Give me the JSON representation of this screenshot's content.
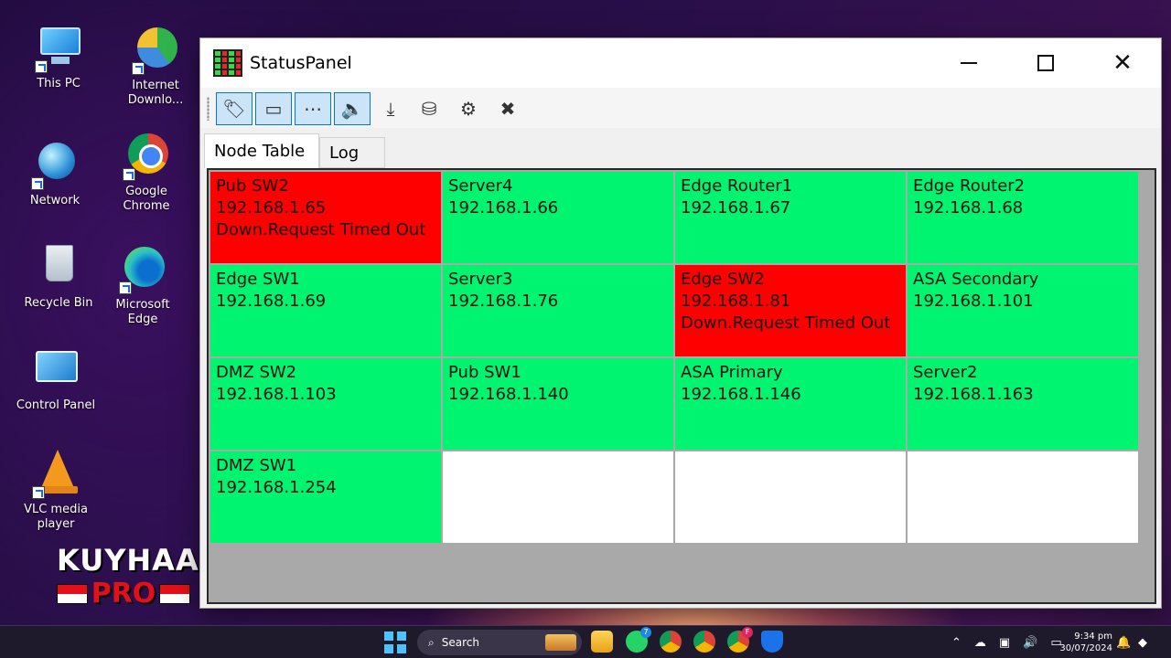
{
  "desktop": {
    "icons": [
      {
        "label_1": "This PC",
        "label_2": ""
      },
      {
        "label_1": "Internet",
        "label_2": "Downlo..."
      },
      {
        "label_1": "Network",
        "label_2": ""
      },
      {
        "label_1": "Google",
        "label_2": "Chrome"
      },
      {
        "label_1": "Recycle Bin",
        "label_2": ""
      },
      {
        "label_1": "Microsoft",
        "label_2": "Edge"
      },
      {
        "label_1": "Control Panel",
        "label_2": ""
      },
      {
        "label_1": "VLC media",
        "label_2": "player"
      }
    ],
    "watermark": {
      "line1": "KUYHAA",
      "line2": "PRO"
    }
  },
  "window": {
    "title": "StatusPanel",
    "controls": {
      "minimize_icon": "minimize-icon",
      "maximize_icon": "maximize-icon",
      "close_icon": "close-icon",
      "close_glyph": "✕"
    },
    "toolbar": {
      "buttons": [
        {
          "icon": "tag-icon",
          "glyph": "🏷",
          "pressed": true
        },
        {
          "icon": "address-card-icon",
          "glyph": "▭",
          "pressed": true
        },
        {
          "icon": "ellipsis-box-icon",
          "glyph": "⋯",
          "pressed": true
        },
        {
          "icon": "speaker-icon",
          "glyph": "🔈",
          "pressed": true
        },
        {
          "icon": "download-icon",
          "glyph": "⤓",
          "pressed": false
        },
        {
          "icon": "network-drive-icon",
          "glyph": "⛁",
          "pressed": false
        },
        {
          "icon": "gear-icon",
          "glyph": "⚙",
          "pressed": false
        },
        {
          "icon": "close-box-icon",
          "glyph": "✖",
          "pressed": false
        }
      ]
    },
    "tabs": [
      {
        "label": "Node Table",
        "active": true
      },
      {
        "label": "Log",
        "active": false
      }
    ],
    "nodes": [
      {
        "name": "Pub SW2",
        "ip": "192.168.1.65",
        "status": "down",
        "message": "Down.Request Timed Out"
      },
      {
        "name": "Server4",
        "ip": "192.168.1.66",
        "status": "up",
        "message": ""
      },
      {
        "name": "Edge Router1",
        "ip": "192.168.1.67",
        "status": "up",
        "message": ""
      },
      {
        "name": "Edge Router2",
        "ip": "192.168.1.68",
        "status": "up",
        "message": ""
      },
      {
        "name": "Edge SW1",
        "ip": "192.168.1.69",
        "status": "up",
        "message": ""
      },
      {
        "name": "Server3",
        "ip": "192.168.1.76",
        "status": "up",
        "message": ""
      },
      {
        "name": "Edge SW2",
        "ip": "192.168.1.81",
        "status": "down",
        "message": "Down.Request Timed Out"
      },
      {
        "name": "ASA Secondary",
        "ip": "192.168.1.101",
        "status": "up",
        "message": ""
      },
      {
        "name": "DMZ SW2",
        "ip": "192.168.1.103",
        "status": "up",
        "message": ""
      },
      {
        "name": "Pub SW1",
        "ip": "192.168.1.140",
        "status": "up",
        "message": ""
      },
      {
        "name": "ASA Primary",
        "ip": "192.168.1.146",
        "status": "up",
        "message": ""
      },
      {
        "name": "Server2",
        "ip": "192.168.1.163",
        "status": "up",
        "message": ""
      },
      {
        "name": "DMZ SW1",
        "ip": "192.168.1.254",
        "status": "up",
        "message": ""
      },
      {
        "name": "",
        "ip": "",
        "status": "empty",
        "message": ""
      },
      {
        "name": "",
        "ip": "",
        "status": "empty",
        "message": ""
      },
      {
        "name": "",
        "ip": "",
        "status": "empty",
        "message": ""
      }
    ],
    "colors": {
      "up": "#00f46f",
      "down": "#ff0000",
      "empty": "#ffffff"
    }
  },
  "taskbar": {
    "search_label": "Search",
    "whatsapp_badge": "7",
    "chrome_badge": "F",
    "time": "9:34 pm",
    "date": "30/07/2024"
  }
}
